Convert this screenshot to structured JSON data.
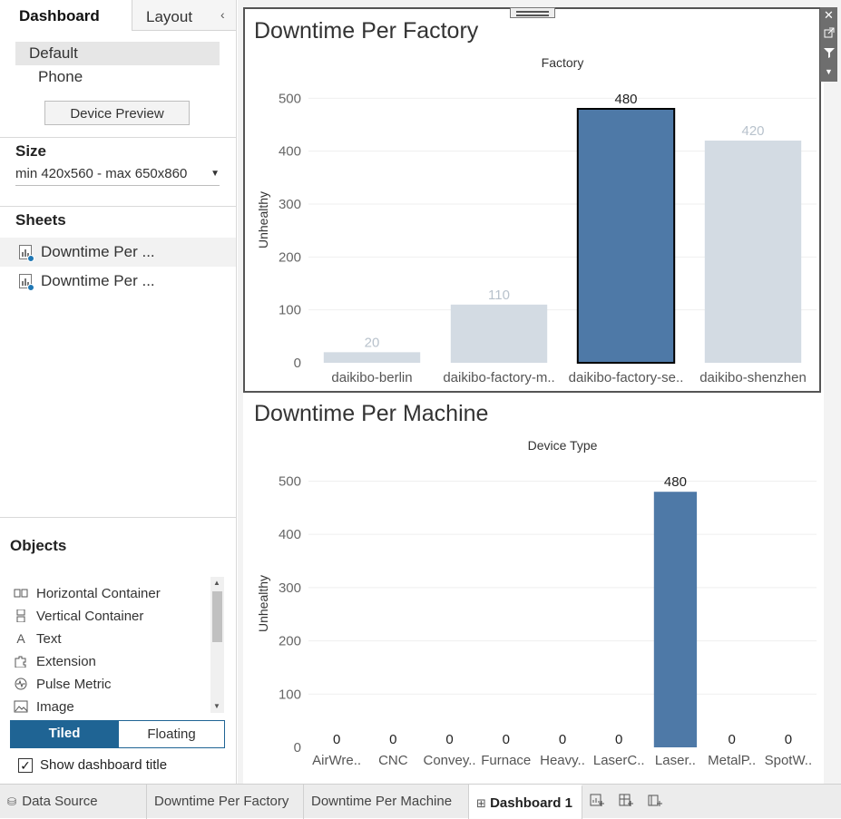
{
  "sidebar": {
    "tabs": {
      "dashboard": "Dashboard",
      "layout": "Layout"
    },
    "collapse_glyph": "‹",
    "devices": {
      "default": "Default",
      "phone": "Phone",
      "preview_button": "Device Preview"
    },
    "size": {
      "title": "Size",
      "value": "min 420x560 - max 650x860"
    },
    "sheets": {
      "title": "Sheets",
      "items": [
        "Downtime Per ...",
        "Downtime Per ..."
      ]
    },
    "objects": {
      "title": "Objects",
      "items": [
        {
          "label": "Horizontal Container",
          "icon": "horizontal-container-icon"
        },
        {
          "label": "Vertical Container",
          "icon": "vertical-container-icon"
        },
        {
          "label": "Text",
          "icon": "text-icon"
        },
        {
          "label": "Extension",
          "icon": "extension-icon"
        },
        {
          "label": "Pulse Metric",
          "icon": "pulse-metric-icon"
        },
        {
          "label": "Image",
          "icon": "image-icon"
        }
      ]
    },
    "mode": {
      "tiled": "Tiled",
      "floating": "Floating"
    },
    "show_title": {
      "label": "Show dashboard title",
      "checked": true
    }
  },
  "panels": {
    "factory": {
      "title": "Downtime Per Factory"
    },
    "machine": {
      "title": "Downtime Per Machine"
    }
  },
  "bottom_tabs": {
    "data_source": "Data Source",
    "sheet1": "Downtime Per Factory",
    "sheet2": "Downtime Per Machine",
    "dashboard": "Dashboard 1"
  },
  "chart_data": [
    {
      "type": "bar",
      "title": "Downtime Per Factory",
      "header": "Factory",
      "ylabel": "Unhealthy",
      "ylim": [
        0,
        540
      ],
      "yticks": [
        0,
        100,
        200,
        300,
        400,
        500
      ],
      "categories": [
        "daikibo-berlin",
        "daikibo-factory-m..",
        "daikibo-factory-se..",
        "daikibo-shenzhen"
      ],
      "values": [
        20,
        110,
        480,
        420
      ],
      "highlighted_index": 2,
      "colors": {
        "highlight": "#4e79a7",
        "muted": "#d3dbe3",
        "muted_label": "#b8c2cc",
        "highlight_label": "#222222"
      }
    },
    {
      "type": "bar",
      "title": "Downtime Per Machine",
      "header": "Device Type",
      "ylabel": "Unhealthy",
      "ylim": [
        0,
        540
      ],
      "yticks": [
        0,
        100,
        200,
        300,
        400,
        500
      ],
      "categories": [
        "AirWre..",
        "CNC",
        "Convey..",
        "Furnace",
        "Heavy..",
        "LaserC..",
        "Laser..",
        "MetalP..",
        "SpotW.."
      ],
      "values": [
        0,
        0,
        0,
        0,
        0,
        0,
        480,
        0,
        0
      ],
      "colors": {
        "bar": "#4e79a7",
        "label": "#222222"
      }
    }
  ]
}
